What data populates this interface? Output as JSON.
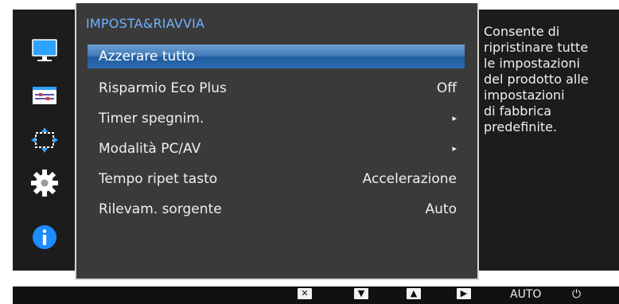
{
  "osd": {
    "sidebar_icons": [
      {
        "name": "picture-icon",
        "active": true
      },
      {
        "name": "onscreen-display-icon",
        "active": false
      },
      {
        "name": "position-size-icon",
        "active": false
      },
      {
        "name": "system-settings-icon",
        "active": false
      },
      {
        "name": "information-icon",
        "active": false
      }
    ],
    "menu": {
      "title": "IMPOSTA&RIAVVIA",
      "items": [
        {
          "label": "Azzerare tutto",
          "value": "",
          "selected": true
        },
        {
          "label": "Risparmio Eco Plus",
          "value": "Off"
        },
        {
          "label": "Timer spegnim.",
          "value": "▸"
        },
        {
          "label": "Modalità PC/AV",
          "value": "▸"
        },
        {
          "label": "Tempo ripet tasto",
          "value": "Accelerazione"
        },
        {
          "label": "Rilevam. sorgente",
          "value": "Auto"
        }
      ]
    },
    "description": [
      "Consente di",
      "ripristinare tutte",
      "le impostazioni",
      "del prodotto alle",
      "impostazioni",
      "di fabbrica",
      "predefinite."
    ],
    "colors": {
      "title": "#6fb2ff",
      "highlight": "#2a6bb0",
      "panel": "#3a3a3a",
      "background": "#1c1c1c"
    }
  },
  "bottom_bar": {
    "buttons": [
      {
        "name": "close-button",
        "glyph": "✕"
      },
      {
        "name": "down-button",
        "glyph": "▼"
      },
      {
        "name": "up-button",
        "glyph": "▲"
      },
      {
        "name": "enter-button",
        "glyph": "▶"
      },
      {
        "name": "auto-button",
        "label": "AUTO"
      },
      {
        "name": "power-button",
        "glyph": "⏻"
      }
    ]
  }
}
